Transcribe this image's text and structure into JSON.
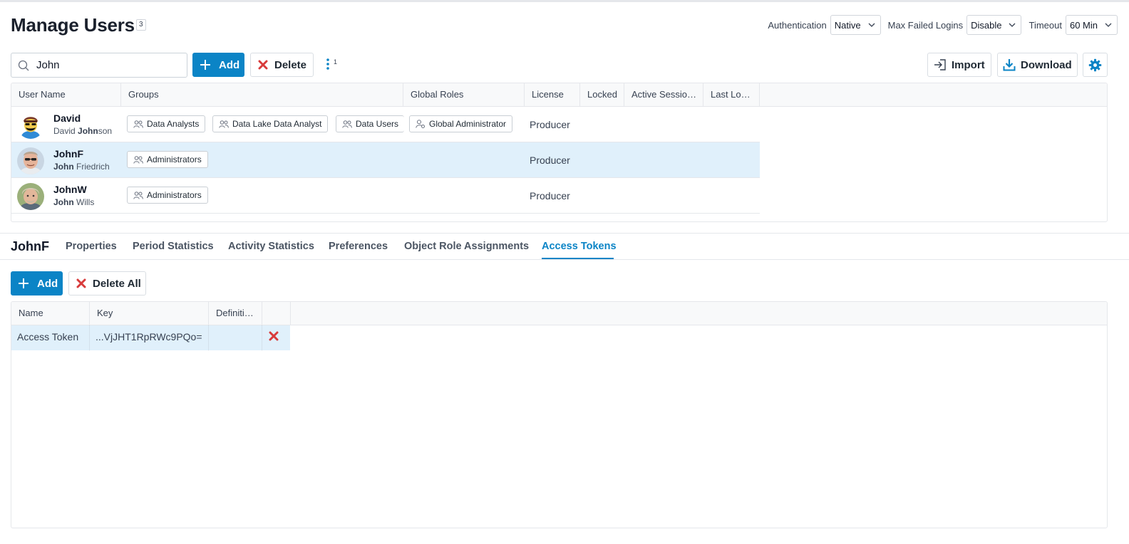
{
  "header": {
    "title": "Manage Users",
    "count": "3",
    "auth_label": "Authentication",
    "auth_value": "Native",
    "max_failed_label": "Max Failed Logins",
    "max_failed_value": "Disable",
    "timeout_label": "Timeout",
    "timeout_value": "60 Min"
  },
  "toolbar": {
    "search_value": "John",
    "add_label": "Add",
    "delete_label": "Delete",
    "more_count": "1",
    "import_label": "Import",
    "download_label": "Download"
  },
  "users_table": {
    "columns": [
      "User Name",
      "Groups",
      "Global Roles",
      "License",
      "Locked",
      "Active Sessio…",
      "Last Lo…"
    ],
    "rows": [
      {
        "username": "David",
        "fullname_pre": "David ",
        "fullname_match": "John",
        "fullname_post": "son",
        "groups": [
          "Data Analysts",
          "Data Lake Data Analyst",
          "Data Users"
        ],
        "roles": [
          "Global Administrator"
        ],
        "license": "Producer"
      },
      {
        "username": "JohnF",
        "fullname_pre": "",
        "fullname_match": "John",
        "fullname_post": " Friedrich",
        "groups": [
          "Administrators"
        ],
        "roles": [],
        "license": "Producer"
      },
      {
        "username": "JohnW",
        "fullname_pre": "",
        "fullname_match": "John",
        "fullname_post": " Wills",
        "groups": [
          "Administrators"
        ],
        "roles": [],
        "license": "Producer"
      }
    ]
  },
  "detail": {
    "title": "JohnF",
    "tabs": [
      "Properties",
      "Period Statistics",
      "Activity Statistics",
      "Preferences",
      "Object Role Assignments",
      "Access Tokens"
    ],
    "active_tab": "Access Tokens",
    "add_label": "Add",
    "delete_all_label": "Delete All",
    "token_columns": [
      "Name",
      "Key",
      "Definiti…",
      ""
    ],
    "tokens": [
      {
        "name": "Access Token",
        "key": "...VjJHT1RpRWc9PQo=",
        "definition": ""
      }
    ]
  },
  "colors": {
    "accent": "#0b84c6",
    "selected_row": "#e0f0fb",
    "delete_red": "#d83b3b"
  }
}
